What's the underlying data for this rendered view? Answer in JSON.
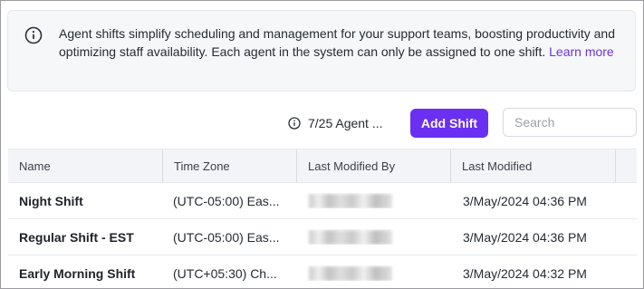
{
  "info": {
    "text": "Agent shifts simplify scheduling and management for your support teams, boosting productivity and optimizing staff availability. Each agent in the system can only be assigned to one shift.",
    "link": "Learn more"
  },
  "toolbar": {
    "agent_count": "7/25 Agent ...",
    "add_shift_label": "Add Shift",
    "search_placeholder": "Search"
  },
  "table": {
    "headers": [
      "Name",
      "Time Zone",
      "Last Modified By",
      "Last Modified"
    ],
    "rows": [
      {
        "name": "Night Shift",
        "time_zone": "(UTC-05:00) Eas...",
        "modified_by": "",
        "modified": "3/May/2024 04:36 PM"
      },
      {
        "name": "Regular Shift - EST",
        "time_zone": "(UTC-05:00) Eas...",
        "modified_by": "",
        "modified": "3/May/2024 04:36 PM"
      },
      {
        "name": "Early Morning Shift",
        "time_zone": "(UTC+05:30) Ch...",
        "modified_by": "",
        "modified": "3/May/2024 04:32 PM"
      }
    ]
  },
  "colors": {
    "accent": "#6a2ff0",
    "link": "#6b35d6"
  }
}
